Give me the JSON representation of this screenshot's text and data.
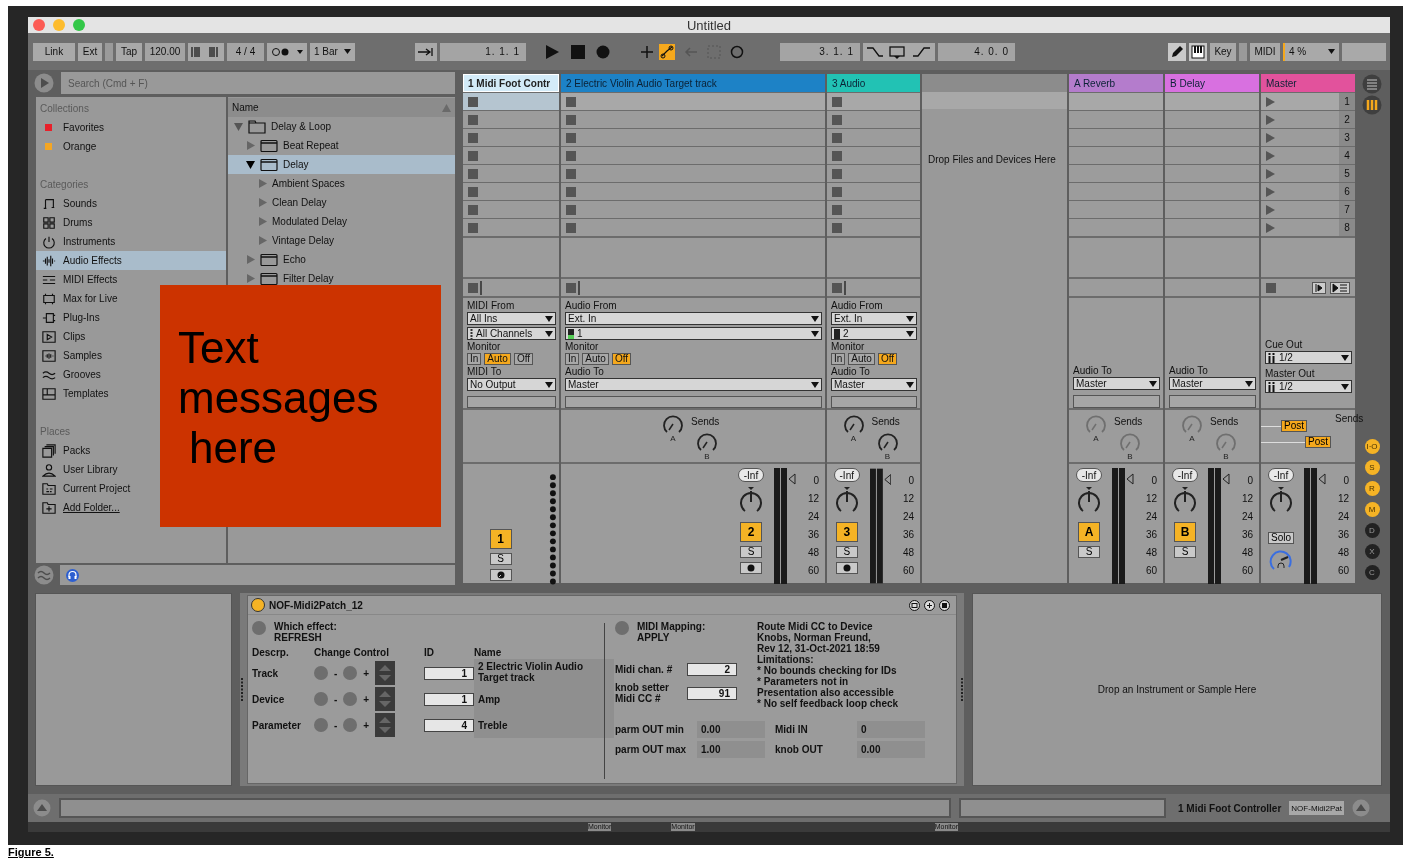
{
  "window": {
    "title": "Untitled"
  },
  "control_bar": {
    "link": "Link",
    "ext": "Ext",
    "tap": "Tap",
    "tempo": "120.00",
    "signature": "4 / 4",
    "quantization": "1 Bar",
    "position": "1. 1. 1",
    "loop_start": "3. 1. 1",
    "loop_length": "4. 0. 0",
    "key": "Key",
    "midi": "MIDI",
    "cpu_load": "4 %",
    "automation_arm": {
      "on": true
    }
  },
  "browser": {
    "search": {
      "placeholder": "Search (Cmd + F)"
    },
    "sections": [
      {
        "title": "Collections",
        "items": [
          {
            "label": "Favorites",
            "color": "#e8202a",
            "selected": false
          },
          {
            "label": "Orange",
            "color": "#f5a623",
            "selected": false
          }
        ]
      },
      {
        "title": "Categories",
        "items": [
          {
            "label": "Sounds",
            "selected": false
          },
          {
            "label": "Drums",
            "selected": false
          },
          {
            "label": "Instruments",
            "selected": false
          },
          {
            "label": "Audio Effects",
            "selected": true
          },
          {
            "label": "MIDI Effects",
            "selected": false
          },
          {
            "label": "Max for Live",
            "selected": false
          },
          {
            "label": "Plug-Ins",
            "selected": false
          },
          {
            "label": "Clips",
            "selected": false
          },
          {
            "label": "Samples",
            "selected": false
          },
          {
            "label": "Grooves",
            "selected": false
          },
          {
            "label": "Templates",
            "selected": false
          }
        ]
      },
      {
        "title": "Places",
        "items": [
          {
            "label": "Packs",
            "kind": "place",
            "selected": false
          },
          {
            "label": "User Library",
            "kind": "place",
            "selected": false
          },
          {
            "label": "Current Project",
            "kind": "place",
            "selected": false
          },
          {
            "label": "Add Folder...",
            "kind": "link",
            "selected": false
          }
        ]
      }
    ],
    "list": {
      "column": "Name",
      "items": [
        {
          "label": "Delay & Loop",
          "kind": "folder",
          "expanded": true,
          "selected": false,
          "children": [
            {
              "label": "Beat Repeat",
              "kind": "device",
              "expanded": false,
              "selected": false
            },
            {
              "label": "Delay",
              "kind": "device",
              "expanded": true,
              "selected": true,
              "children": [
                {
                  "label": "Ambient Spaces",
                  "kind": "preset_folder",
                  "expanded": false,
                  "selected": false
                },
                {
                  "label": "Clean Delay",
                  "kind": "preset_folder",
                  "expanded": false,
                  "selected": false
                },
                {
                  "label": "Modulated Delay",
                  "kind": "preset_folder",
                  "expanded": false,
                  "selected": false
                },
                {
                  "label": "Vintage Delay",
                  "kind": "preset_folder",
                  "expanded": false,
                  "selected": false
                }
              ]
            },
            {
              "label": "Echo",
              "kind": "device",
              "expanded": false,
              "selected": false
            },
            {
              "label": "Filter Delay",
              "kind": "device",
              "expanded": false,
              "selected": false
            }
          ]
        }
      ]
    }
  },
  "note": {
    "lines": [
      "Text",
      "messages",
      "here"
    ]
  },
  "session": {
    "tracks": [
      {
        "kind": "midi",
        "name": "1 Midi Foot Contr",
        "color": "#d3ebf8",
        "selected": true,
        "input_label": "MIDI From",
        "input": "All Ins",
        "channel": "All Channels",
        "monitor_label": "Monitor",
        "monitor": [
          {
            "label": "In",
            "selected": false
          },
          {
            "label": "Auto",
            "selected": true
          },
          {
            "label": "Off",
            "selected": false
          }
        ],
        "output_label": "MIDI To",
        "output": "No Output",
        "activator": "1",
        "active": true,
        "solo": "S"
      },
      {
        "kind": "audio",
        "name": "2 Electric Violin Audio Target track",
        "color": "#1d82c6",
        "selected": false,
        "input_label": "Audio From",
        "input": "Ext. In",
        "channel": "1",
        "monitor_label": "Monitor",
        "monitor": [
          {
            "label": "In",
            "selected": false
          },
          {
            "label": "Auto",
            "selected": false
          },
          {
            "label": "Off",
            "selected": true
          }
        ],
        "output_label": "Audio To",
        "output": "Master",
        "sends_label": "Sends",
        "sends": [
          "A",
          "B"
        ],
        "volume": "-Inf",
        "activator": "2",
        "active": true,
        "solo": "S",
        "meter_scale": [
          "0",
          "12",
          "24",
          "36",
          "48",
          "60"
        ]
      },
      {
        "kind": "audio",
        "name": "3 Audio",
        "color": "#22c2b4",
        "selected": false,
        "input_label": "Audio From",
        "input": "Ext. In",
        "channel": "2",
        "monitor_label": "Monitor",
        "monitor": [
          {
            "label": "In",
            "selected": false
          },
          {
            "label": "Auto",
            "selected": false
          },
          {
            "label": "Off",
            "selected": true
          }
        ],
        "output_label": "Audio To",
        "output": "Master",
        "sends_label": "Sends",
        "sends": [
          "A",
          "B"
        ],
        "volume": "-Inf",
        "activator": "3",
        "active": true,
        "solo": "S",
        "meter_scale": [
          "0",
          "12",
          "24",
          "36",
          "48",
          "60"
        ]
      },
      {
        "kind": "drop",
        "text": "Drop Files and Devices Here"
      },
      {
        "kind": "return",
        "name": "A Reverb",
        "color": "#b47ccc",
        "selected": false,
        "output_label": "Audio To",
        "output": "Master",
        "sends_label": "Sends",
        "sends": [
          "A",
          "B"
        ],
        "volume": "-Inf",
        "activator": "A",
        "active": true,
        "solo": "S",
        "meter_scale": [
          "0",
          "12",
          "24",
          "36",
          "48",
          "60"
        ]
      },
      {
        "kind": "return",
        "name": "B Delay",
        "color": "#d870e0",
        "selected": false,
        "output_label": "Audio To",
        "output": "Master",
        "sends_label": "Sends",
        "sends": [
          "A",
          "B"
        ],
        "volume": "-Inf",
        "activator": "B",
        "active": true,
        "solo": "S",
        "meter_scale": [
          "0",
          "12",
          "24",
          "36",
          "48",
          "60"
        ]
      },
      {
        "kind": "master",
        "name": "Master",
        "color": "#e2529c",
        "selected": false,
        "scenes": [
          {
            "label": "1",
            "selected": true
          },
          {
            "label": "2",
            "selected": false
          },
          {
            "label": "3",
            "selected": false
          },
          {
            "label": "4",
            "selected": false
          },
          {
            "label": "5",
            "selected": false
          },
          {
            "label": "6",
            "selected": false
          },
          {
            "label": "7",
            "selected": false
          },
          {
            "label": "8",
            "selected": false
          }
        ],
        "cue_label": "Cue Out",
        "cue": "1/2",
        "master_out_label": "Master Out",
        "master_out": "1/2",
        "sends_label": "Sends",
        "post_buttons": [
          "Post",
          "Post"
        ],
        "volume": "-Inf",
        "solo": "Solo",
        "meter_scale": [
          "0",
          "12",
          "24",
          "36",
          "48",
          "60"
        ]
      }
    ]
  },
  "view_toggles": [
    {
      "label": "I·O",
      "on": true
    },
    {
      "label": "S",
      "on": true
    },
    {
      "label": "R",
      "on": true
    },
    {
      "label": "M",
      "on": true
    },
    {
      "label": "D",
      "on": false
    },
    {
      "label": "X",
      "on": false
    },
    {
      "label": "C",
      "on": false
    }
  ],
  "device": {
    "title": "NOF-Midi2Patch_12",
    "on": true,
    "effect_label": "Which effect:",
    "effect_action": "REFRESH",
    "columns": [
      "Descrp.",
      "Change Control",
      "ID",
      "Name"
    ],
    "rows": [
      {
        "label": "Track",
        "decrement": "-",
        "increment": "+",
        "id": "1",
        "name": "2 Electric Violin Audio Target track"
      },
      {
        "label": "Device",
        "decrement": "-",
        "increment": "+",
        "id": "1",
        "name": "Amp"
      },
      {
        "label": "Parameter",
        "decrement": "-",
        "increment": "+",
        "id": "4",
        "name": "Treble"
      }
    ],
    "mapping_label": "MIDI Mapping:",
    "mapping_action": "APPLY",
    "midi_channel": {
      "label": "Midi chan. #",
      "value": "2"
    },
    "knob_cc": {
      "label_lines": [
        "knob setter",
        "Midi CC #"
      ],
      "value": "91"
    },
    "info": [
      "Route Midi CC to Device",
      "Knobs, Norman Freund,",
      "Rev 12, 31-Oct-2021 18:59",
      "Limitations:",
      "* No bounds checking for IDs",
      "* Parameters not in",
      "Presentation also accessible",
      "* No self feedback loop check"
    ],
    "readouts": [
      {
        "label": "parm OUT min",
        "value": "0.00"
      },
      {
        "label": "Midi IN",
        "value": "0"
      },
      {
        "label": "parm OUT max",
        "value": "1.00"
      },
      {
        "label": "knob OUT",
        "value": "0.00"
      }
    ]
  },
  "instrument_drop": "Drop an Instrument or Sample Here",
  "status_bar": {
    "track": "1 Midi Foot Controller",
    "device": "NOF-Midi2Pat"
  },
  "background_labels": [
    "Monitor",
    "Monitor",
    "Monitor"
  ],
  "caption": "Figure 5."
}
